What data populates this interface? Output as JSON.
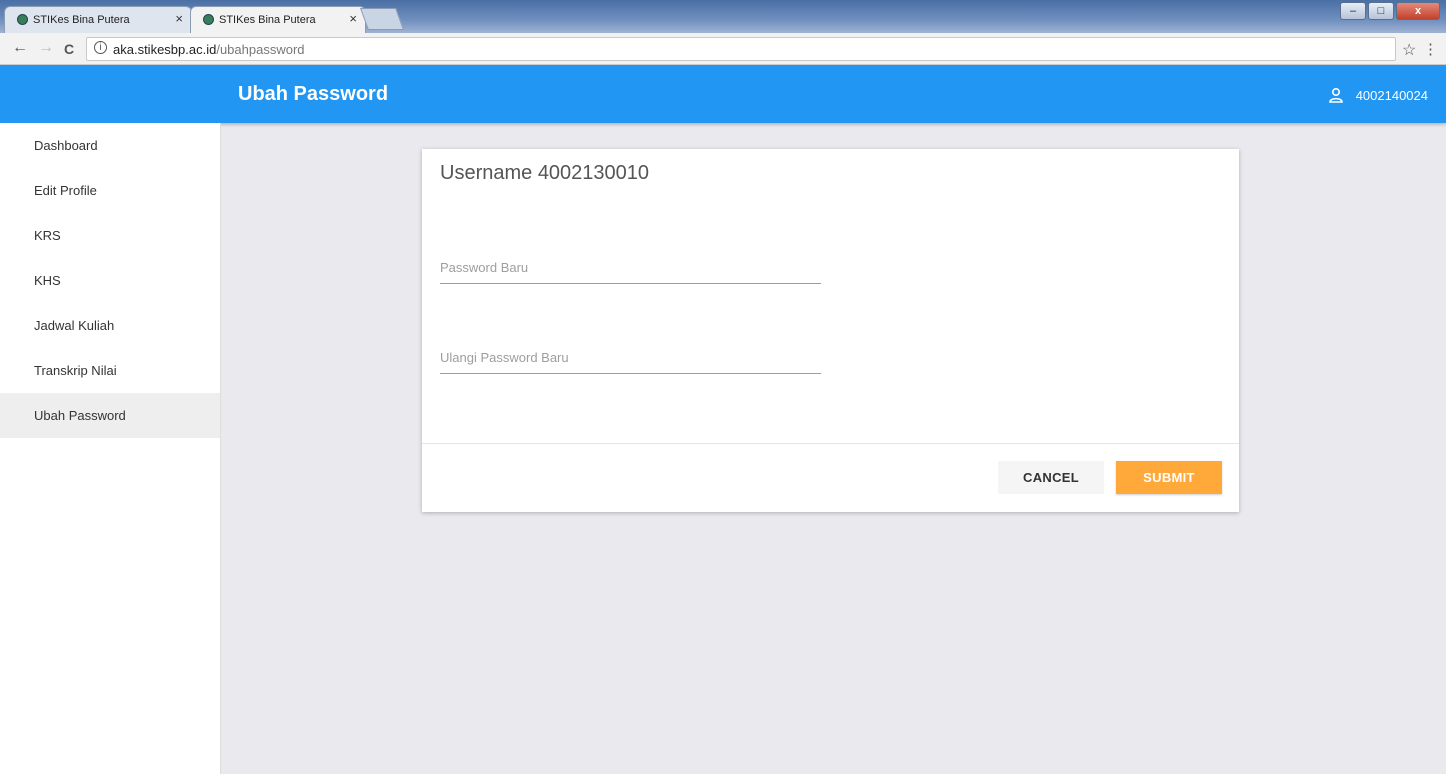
{
  "browser": {
    "tabs": [
      {
        "title": "STIKes Bina Putera",
        "close": "×"
      },
      {
        "title": "STIKes Bina Putera",
        "close": "×"
      }
    ],
    "window_controls": {
      "minimize": "–",
      "maximize": "□",
      "close": "x"
    },
    "nav": {
      "back": "←",
      "forward": "→",
      "reload": "C"
    },
    "address": {
      "info": "i",
      "host": "aka.stikesbp.ac.id",
      "path": "/ubahpassword"
    },
    "star": "☆",
    "menu": "⋮"
  },
  "appbar": {
    "title": "Ubah Password",
    "user_id": "4002140024"
  },
  "sidebar": {
    "items": [
      {
        "label": "Dashboard"
      },
      {
        "label": "Edit Profile"
      },
      {
        "label": "KRS"
      },
      {
        "label": "KHS"
      },
      {
        "label": "Jadwal Kuliah"
      },
      {
        "label": "Transkrip Nilai"
      },
      {
        "label": "Ubah Password",
        "active": true
      }
    ]
  },
  "form": {
    "title": "Username 4002130010",
    "new_password_placeholder": "Password Baru",
    "repeat_password_placeholder": "Ulangi Password Baru",
    "cancel_label": "CANCEL",
    "submit_label": "SUBMIT"
  },
  "colors": {
    "appbar": "#2196f3",
    "submit": "#ffa93b",
    "background": "#e9e9ee"
  },
  "icons": {
    "user": "user-icon",
    "favicon": "site-favicon-icon"
  }
}
